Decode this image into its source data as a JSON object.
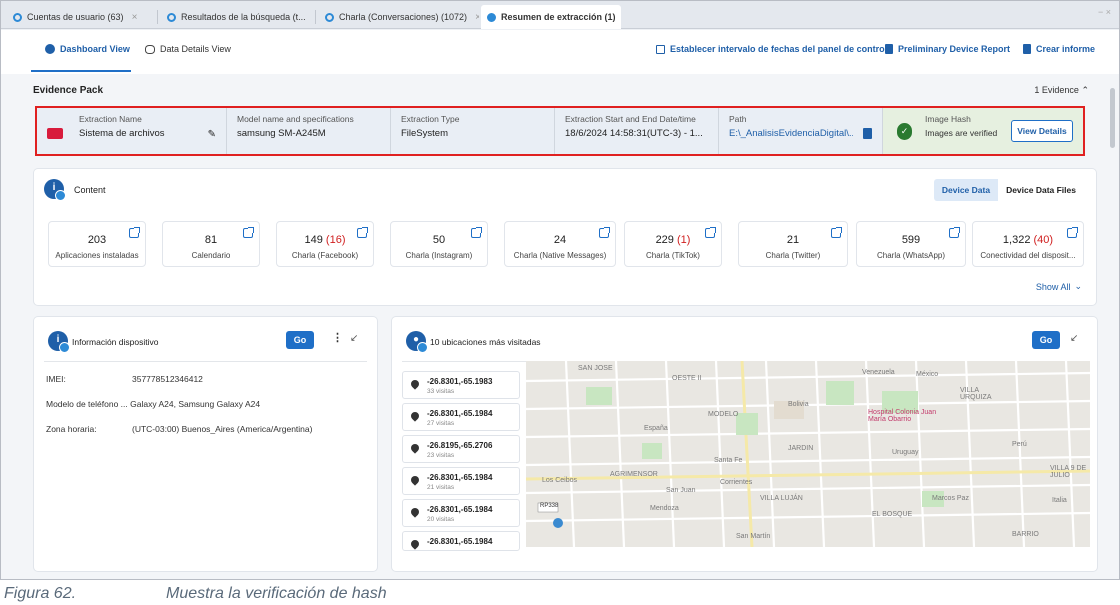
{
  "tabs": [
    {
      "label": "Cuentas de usuario (63)"
    },
    {
      "label": "Resultados de la búsqueda (t..."
    },
    {
      "label": "Charla (Conversaciones) (1072)"
    },
    {
      "label": "Resumen de extracción (1)"
    }
  ],
  "tab_close": "×",
  "window_controls": "− ×",
  "views": {
    "dashboard": "Dashboard View",
    "data_details": "Data Details View"
  },
  "actions": {
    "date_range": "Establecer intervalo de fechas del panel de control",
    "preliminary": "Preliminary Device Report",
    "report": "Crear informe"
  },
  "evidence": {
    "title": "Evidence Pack",
    "count": "1 Evidence",
    "fields": {
      "extraction_name_label": "Extraction Name",
      "extraction_name": "Sistema de archivos",
      "model_label": "Model name and specifications",
      "model": "samsung SM-A245M",
      "type_label": "Extraction Type",
      "type": "FileSystem",
      "dates_label": "Extraction Start and End Date/time",
      "dates": "18/6/2024 14:58:31(UTC-3) - 1...",
      "path_label": "Path",
      "path": "E:\\_AnalisisEvidenciaDigital\\...",
      "hash_label": "Image Hash",
      "hash_status": "Images are verified",
      "view_details": "View Details"
    }
  },
  "content": {
    "title": "Content",
    "toggle": {
      "device_data": "Device Data",
      "device_data_files": "Device Data Files"
    },
    "stats": [
      {
        "value": "203",
        "extra": "",
        "label": "Aplicaciones instaladas"
      },
      {
        "value": "81",
        "extra": "",
        "label": "Calendario"
      },
      {
        "value": "149",
        "extra": "(16)",
        "label": "Charla (Facebook)"
      },
      {
        "value": "50",
        "extra": "",
        "label": "Charla (Instagram)"
      },
      {
        "value": "24",
        "extra": "",
        "label": "Charla (Native Messages)"
      },
      {
        "value": "229",
        "extra": "(1)",
        "label": "Charla (TikTok)"
      },
      {
        "value": "21",
        "extra": "",
        "label": "Charla (Twitter)"
      },
      {
        "value": "599",
        "extra": "",
        "label": "Charla (WhatsApp)"
      },
      {
        "value": "1,322",
        "extra": "(40)",
        "label": "Conectividad del disposit..."
      }
    ],
    "show_all": "Show All"
  },
  "device_info": {
    "title": "Información dispositivo",
    "go": "Go",
    "rows": [
      {
        "key": "IMEI:",
        "value": "357778512346412"
      },
      {
        "key": "Modelo de teléfono ...",
        "value": "Galaxy A24, Samsung Galaxy A24"
      },
      {
        "key": "Zona horaria:",
        "value": "(UTC-03:00) Buenos_Aires (America/Argentina)"
      }
    ]
  },
  "locations": {
    "title": "10 ubicaciones más visitadas",
    "go": "Go",
    "items": [
      {
        "coords": "-26.8301,-65.1983",
        "visits": "33 visitas"
      },
      {
        "coords": "-26.8301,-65.1984",
        "visits": "27 visitas"
      },
      {
        "coords": "-26.8195,-65.2706",
        "visits": "23 visitas"
      },
      {
        "coords": "-26.8301,-65.1984",
        "visits": "21 visitas"
      },
      {
        "coords": "-26.8301,-65.1984",
        "visits": "20 visitas"
      },
      {
        "coords": "-26.8301,-65.1984",
        "visits": ""
      }
    ],
    "map_labels": {
      "l1": "SAN JOSE",
      "l2": "OESTE II",
      "l3": "MODELO",
      "l4": "España",
      "l5": "JARDIN",
      "l6": "Venezuela",
      "l7": "México",
      "l8": "Hospital Colonia Juan María Obarrio",
      "l9": "VILLA URQUIZA",
      "l10": "AGRIMENSOR",
      "l11": "San Juan",
      "l12": "VILLA LUJÁN",
      "l13": "EL BOSQUE",
      "l14": "Santa Fe",
      "l15": "Corrientes",
      "l16": "Mendoza",
      "l17": "San Martín",
      "l18": "BARRIO",
      "l19": "Perú",
      "l20": "Uruguay",
      "l21": "VILLA 9 DE JULIO",
      "l22": "Italia",
      "l23": "Los Ceibos",
      "l24": "RP338",
      "l25": "Marcos Paz",
      "l26": "Bolivia"
    }
  },
  "caption": {
    "figure": "Figura 62.",
    "text": "Muestra la verificación de hash"
  }
}
